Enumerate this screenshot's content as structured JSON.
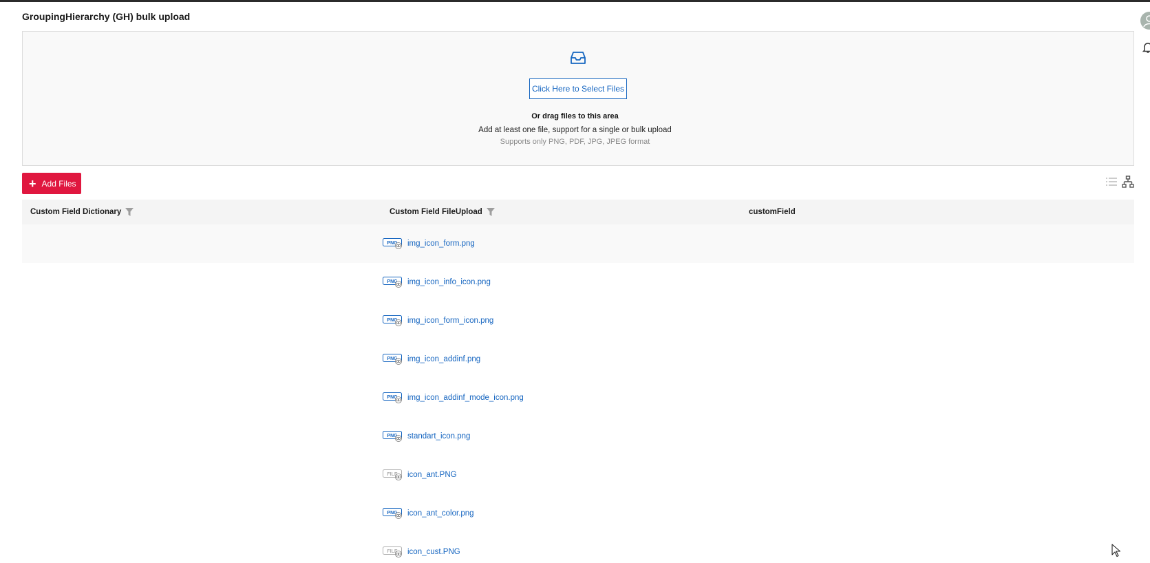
{
  "page": {
    "title": "GroupingHierarchy (GH) bulk upload"
  },
  "dropzone": {
    "icon": "inbox-icon",
    "select_button": "Click Here to Select Files",
    "drag_text": "Or drag files to this area",
    "description": "Add at least one file, support for a single or bulk upload",
    "supported": "Supports only PNG, PDF, JPG, JPEG format"
  },
  "toolbar": {
    "add_files_label": "Add Files",
    "add_icon": "plus-icon",
    "list_view_icon": "list-view-icon",
    "tree_view_icon": "hierarchy-view-icon"
  },
  "table": {
    "columns": [
      {
        "label": "Custom Field Dictionary",
        "filter": true
      },
      {
        "label": "Custom Field FileUpload",
        "filter": true
      },
      {
        "label": "customField",
        "filter": false
      }
    ],
    "rows": [
      {
        "dictionary": "",
        "file": "img_icon_form.png",
        "badge": "PNG",
        "custom": ""
      },
      {
        "dictionary": "",
        "file": "img_icon_info_icon.png",
        "badge": "PNG",
        "custom": ""
      },
      {
        "dictionary": "",
        "file": "img_icon_form_icon.png",
        "badge": "PNG",
        "custom": ""
      },
      {
        "dictionary": "",
        "file": "img_icon_addinf.png",
        "badge": "PNG",
        "custom": ""
      },
      {
        "dictionary": "",
        "file": "img_icon_addinf_mode_icon.png",
        "badge": "PNG",
        "custom": ""
      },
      {
        "dictionary": "",
        "file": "standart_icon.png",
        "badge": "PNG",
        "custom": ""
      },
      {
        "dictionary": "",
        "file": "icon_ant.PNG",
        "badge": "FILE",
        "custom": ""
      },
      {
        "dictionary": "",
        "file": "icon_ant_color.png",
        "badge": "PNG",
        "custom": ""
      },
      {
        "dictionary": "",
        "file": "icon_cust.PNG",
        "badge": "FILE",
        "custom": ""
      }
    ]
  },
  "colors": {
    "accent": "#e0173f",
    "link": "#1565c0",
    "header_bg": "#f4f4f4"
  }
}
